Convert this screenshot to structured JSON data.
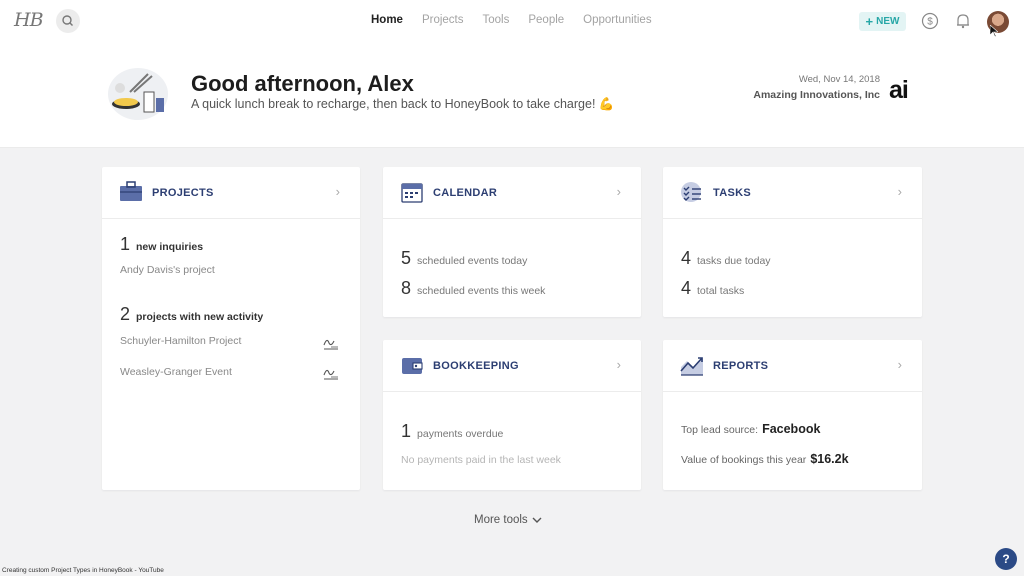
{
  "app": {
    "logo": "HB",
    "footer": "Creating custom Project Types in HoneyBook - YouTube"
  },
  "nav": {
    "items": [
      {
        "label": "Home",
        "active": true
      },
      {
        "label": "Projects"
      },
      {
        "label": "Tools"
      },
      {
        "label": "People"
      },
      {
        "label": "Opportunities"
      }
    ],
    "new_label": "NEW",
    "icons": [
      "search-icon",
      "dollar-icon",
      "bell-icon",
      "avatar"
    ]
  },
  "hero": {
    "greeting": "Good afternoon, Alex",
    "subtitle": "A quick lunch break to recharge, then back to HoneyBook to take charge! 💪",
    "date": "Wed, Nov 14, 2018",
    "company": "Amazing Innovations, Inc",
    "company_logo": "ai"
  },
  "projects": {
    "title": "PROJECTS",
    "inquiries_count": "1",
    "inquiries_label": "new inquiries",
    "inquiry_item": "Andy Davis's project",
    "activity_count": "2",
    "activity_label": "projects with new activity",
    "activity_items": [
      "Schuyler-Hamilton Project",
      "Weasley-Granger Event"
    ]
  },
  "calendar": {
    "title": "CALENDAR",
    "today_count": "5",
    "today_label": "scheduled events today",
    "week_count": "8",
    "week_label": "scheduled events this week"
  },
  "tasks": {
    "title": "TASKS",
    "due_count": "4",
    "due_label": "tasks due today",
    "total_count": "4",
    "total_label": "total tasks"
  },
  "bookkeeping": {
    "title": "BOOKKEEPING",
    "overdue_count": "1",
    "overdue_label": "payments overdue",
    "paid_label": "No payments paid in the last week"
  },
  "reports": {
    "title": "REPORTS",
    "lead_label": "Top lead source:",
    "lead_value": "Facebook",
    "bookings_label": "Value of bookings this year",
    "bookings_value": "$16.2k"
  },
  "more_tools": "More tools",
  "help": "?",
  "colors": {
    "accent": "#2c3e72",
    "new_bg": "#e3f4f4",
    "new_text": "#27a7a7",
    "help_bg": "#2b4a86"
  }
}
